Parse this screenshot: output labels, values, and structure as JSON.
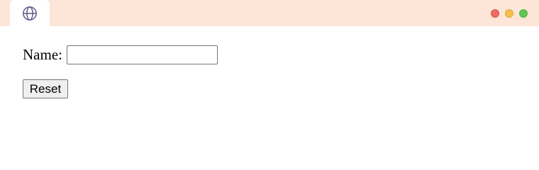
{
  "window": {
    "titlebar_color": "#fde6d7",
    "tab_icon": "globe-icon",
    "controls": [
      {
        "name": "close",
        "color": "#ee6b60",
        "border": "#d6584e"
      },
      {
        "name": "minimize",
        "color": "#f7c04c",
        "border": "#e0a63a"
      },
      {
        "name": "maximize",
        "color": "#62c555",
        "border": "#4fae44"
      }
    ]
  },
  "form": {
    "name_label": "Name:",
    "name_value": "",
    "reset_label": "Reset"
  }
}
